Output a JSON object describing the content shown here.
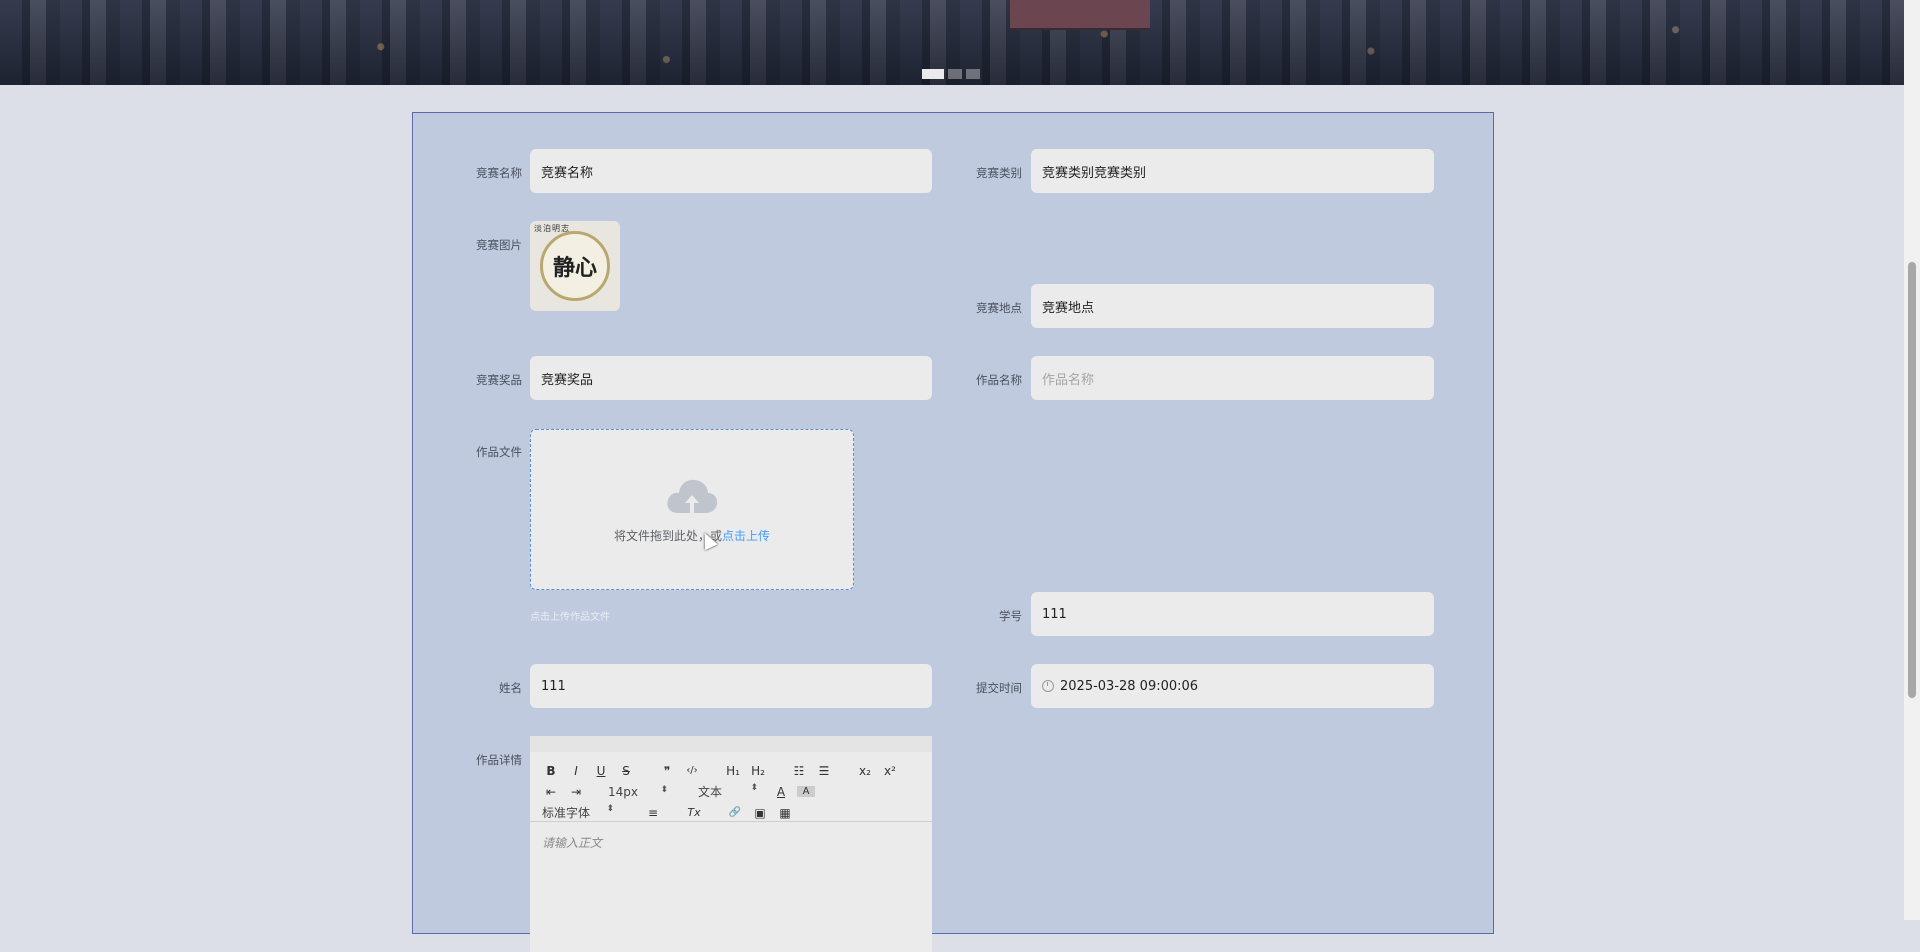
{
  "form": {
    "competition_name": {
      "label": "竞赛名称",
      "value": "竞赛名称"
    },
    "competition_category": {
      "label": "竞赛类别",
      "value": "竞赛类别竞赛类别"
    },
    "competition_image": {
      "label": "竞赛图片",
      "image_text": "静心",
      "stamp_text": "淡泊明志"
    },
    "competition_location": {
      "label": "竞赛地点",
      "value": "竞赛地点"
    },
    "competition_prize": {
      "label": "竞赛奖品",
      "value": "竞赛奖品"
    },
    "work_name": {
      "label": "作品名称",
      "placeholder": "作品名称"
    },
    "work_file": {
      "label": "作品文件",
      "drop_text": "将文件拖到此处，或",
      "upload_link": "点击上传",
      "hint": "点击上传作品文件"
    },
    "student_id": {
      "label": "学号",
      "value": "111"
    },
    "name": {
      "label": "姓名",
      "value": "111"
    },
    "submit_time": {
      "label": "提交时间",
      "value": "2025-03-28 09:00:06"
    },
    "work_details": {
      "label": "作品详情",
      "toolbar": {
        "bold": "B",
        "italic": "I",
        "underline": "U",
        "strike": "S",
        "quote": "❞",
        "code": "‹/›",
        "h1": "H₁",
        "h2": "H₂",
        "ordered_list": "☷",
        "bullet_list": "☰",
        "subscript": "x₂",
        "superscript": "x²",
        "outdent": "⇤",
        "indent": "⇥",
        "font_size": "14px",
        "heading_select": "文本",
        "font_color": "A",
        "background_color": "A",
        "font_family": "标准字体",
        "align": "≡",
        "clear_format": "Tx",
        "link": "🔗",
        "image": "▣",
        "video": "▦"
      },
      "placeholder": "请输入正文"
    }
  }
}
